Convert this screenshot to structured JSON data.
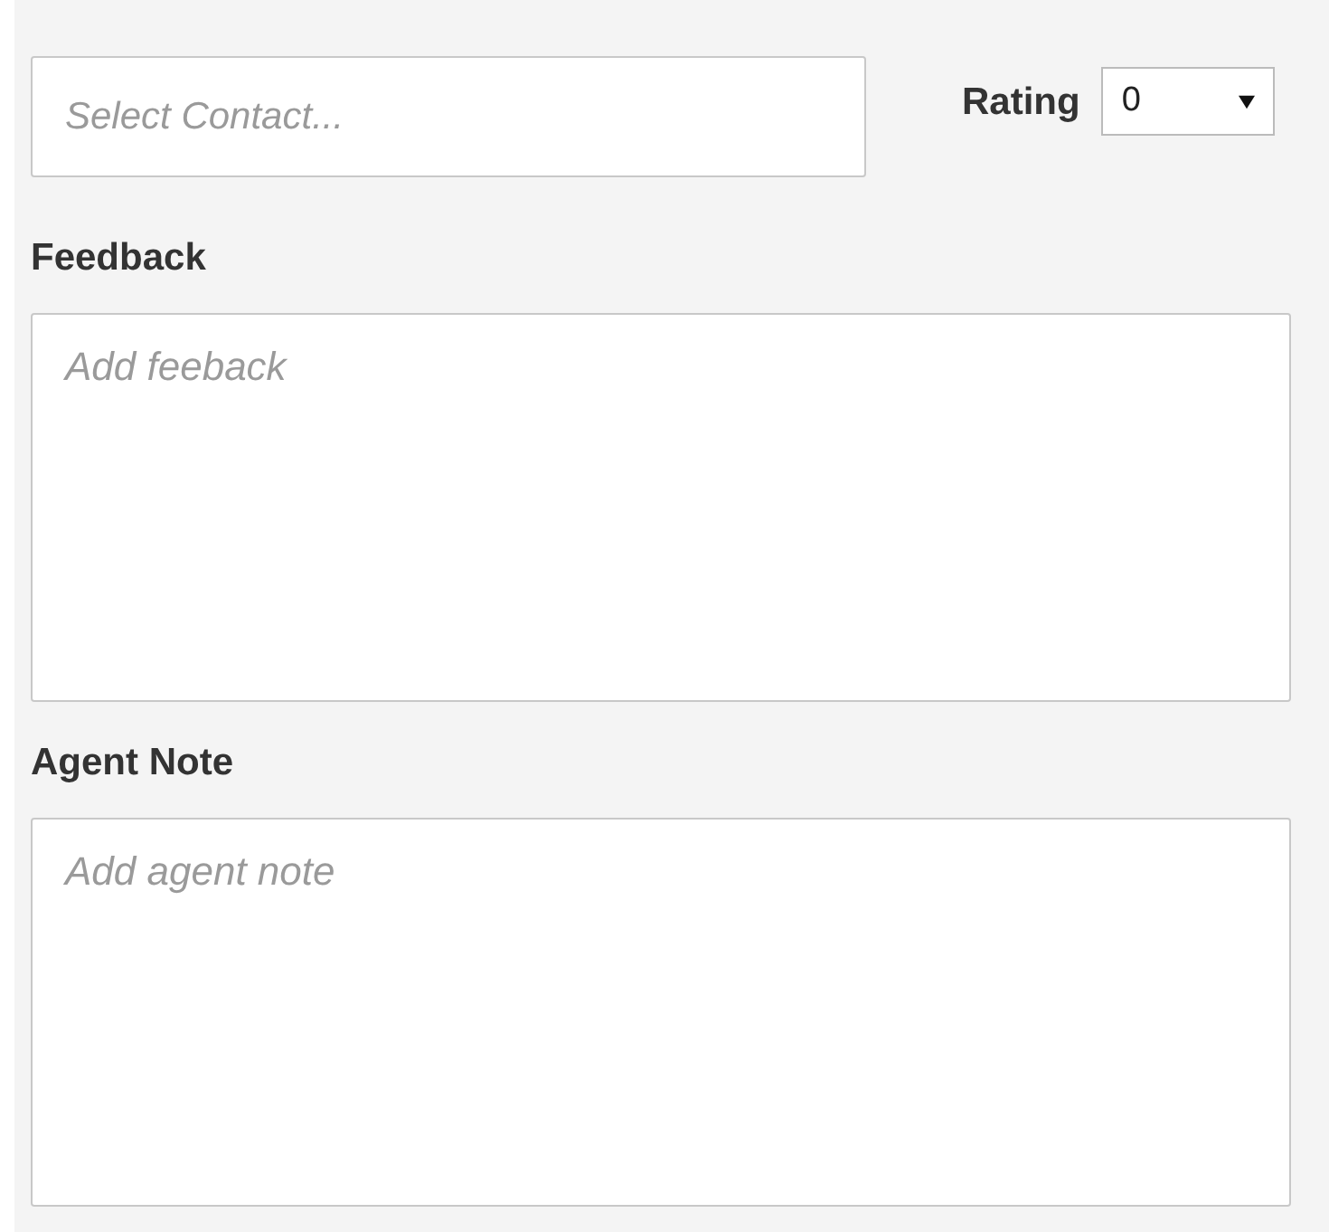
{
  "contact": {
    "placeholder": "Select Contact..."
  },
  "rating": {
    "label": "Rating",
    "value": "0"
  },
  "fields": [
    {
      "label": "Feedback",
      "placeholder": "Add feeback"
    },
    {
      "label": "Agent Note",
      "placeholder": "Add agent note"
    }
  ]
}
